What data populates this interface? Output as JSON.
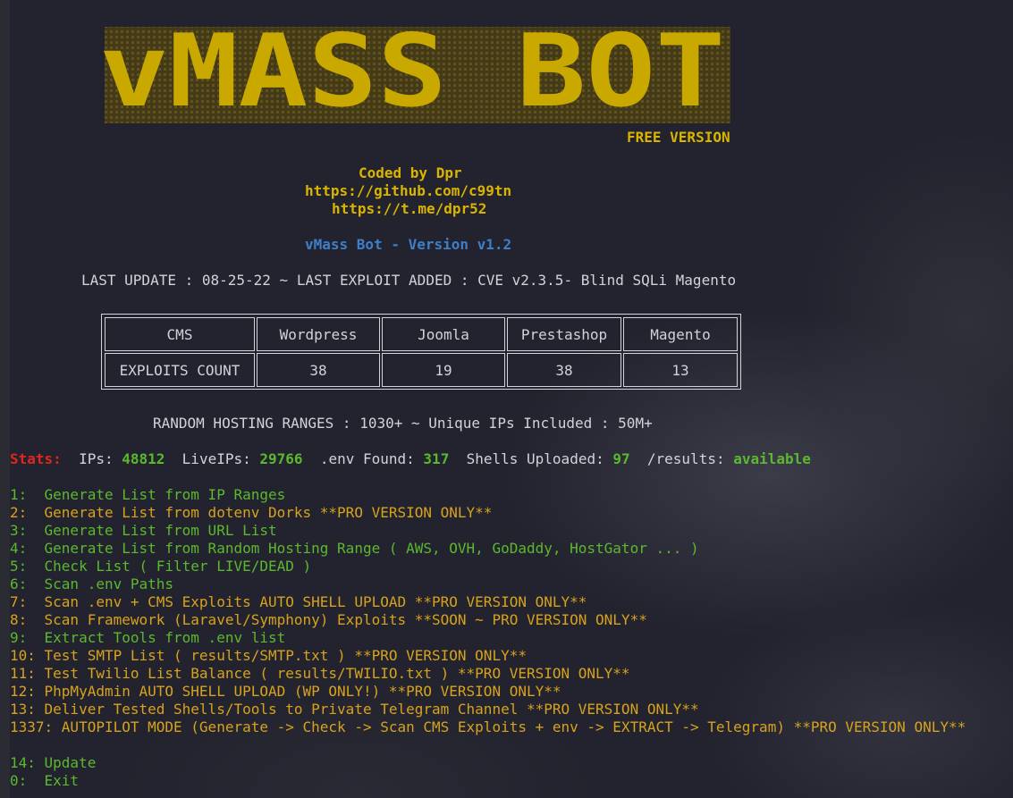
{
  "logo": {
    "text": "vMASS BOT",
    "subtitle": "FREE VERSION"
  },
  "credits": {
    "coded_by": "Coded by Dpr",
    "github": "https://github.com/c99tn",
    "telegram": "https://t.me/dpr52",
    "version": "vMass Bot - Version v1.2"
  },
  "last_update": "LAST UPDATE : 08-25-22 ~ LAST EXPLOIT ADDED : CVE v2.3.5- Blind SQLi Magento",
  "table": {
    "headers": [
      "CMS",
      "Wordpress",
      "Joomla",
      "Prestashop",
      "Magento"
    ],
    "row": [
      "EXPLOITS COUNT",
      "38",
      "19",
      "38",
      "13"
    ]
  },
  "ranges": "RANDOM HOSTING RANGES : 1030+ ~ Unique IPs Included : 50M+",
  "stats": {
    "label": "Stats:",
    "ips_label": "IPs:",
    "ips": "48812",
    "live_label": "LiveIPs:",
    "live": "29766",
    "env_label": ".env Found:",
    "env": "317",
    "shells_label": "Shells Uploaded:",
    "shells": "97",
    "results_label": "/results:",
    "results": "available"
  },
  "menu": [
    {
      "num": "1:  ",
      "text": "Generate List from IP Ranges",
      "color": "#5cb82d"
    },
    {
      "num": "2:  ",
      "text": "Generate List from dotenv Dorks **PRO VERSION ONLY**",
      "color": "#d7a21c"
    },
    {
      "num": "3:  ",
      "text": "Generate List from URL List",
      "color": "#5cb82d"
    },
    {
      "num": "4:  ",
      "text": "Generate List from Random Hosting Range ( AWS, OVH, GoDaddy, HostGator ... )",
      "color": "#5cb82d"
    },
    {
      "num": "5:  ",
      "text": "Check List ( Filter LIVE/DEAD )",
      "color": "#5cb82d"
    },
    {
      "num": "6:  ",
      "text": "Scan .env Paths",
      "color": "#5cb82d"
    },
    {
      "num": "7:  ",
      "text": "Scan .env + CMS Exploits AUTO SHELL UPLOAD **PRO VERSION ONLY**",
      "color": "#d7a21c"
    },
    {
      "num": "8:  ",
      "text": "Scan Framework (Laravel/Symphony) Exploits **SOON ~ PRO VERSION ONLY**",
      "color": "#d7a21c"
    },
    {
      "num": "9:  ",
      "text": "Extract Tools from .env list",
      "color": "#5cb82d"
    },
    {
      "num": "10: ",
      "text": "Test SMTP List ( results/SMTP.txt ) **PRO VERSION ONLY**",
      "color": "#d7a21c"
    },
    {
      "num": "11: ",
      "text": "Test Twilio List Balance ( results/TWILIO.txt ) **PRO VERSION ONLY**",
      "color": "#d7a21c"
    },
    {
      "num": "12: ",
      "text": "PhpMyAdmin AUTO SHELL UPLOAD (WP ONLY!) **PRO VERSION ONLY**",
      "color": "#d7a21c"
    },
    {
      "num": "13: ",
      "text": "Deliver Tested Shells/Tools to Private Telegram Channel **PRO VERSION ONLY**",
      "color": "#d7a21c"
    },
    {
      "num": "1337: ",
      "text": "AUTOPILOT MODE (Generate -> Check -> Scan CMS Exploits + env -> EXTRACT -> Telegram) **PRO VERSION ONLY**",
      "color": "#d7a21c"
    }
  ],
  "footer_menu": [
    {
      "num": "14: ",
      "text": "Update",
      "color": "#5cb82d"
    },
    {
      "num": "0:  ",
      "text": "Exit",
      "color": "#5cb82d"
    }
  ]
}
